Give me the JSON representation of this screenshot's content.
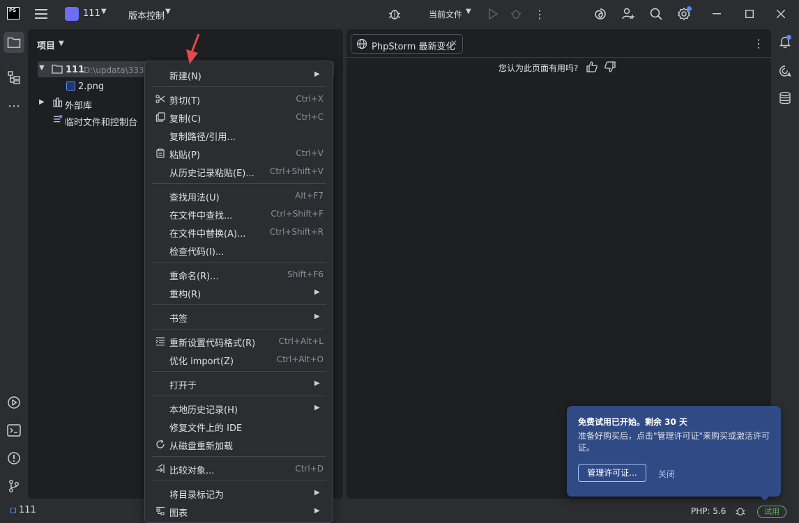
{
  "titlebar": {
    "logo_text": "PS",
    "project_name": "111",
    "vcs_label": "版本控制",
    "run_config": "当前文件"
  },
  "project_panel": {
    "header": "项目",
    "tree": {
      "root_name": "111",
      "root_path": "D:\\updata\\333\\",
      "file": "2.png",
      "external_libs": "外部库",
      "scratches": "临时文件和控制台"
    }
  },
  "context_menu": {
    "items": [
      {
        "label": "新建(N)",
        "shortcut": "",
        "submenu": true
      },
      {
        "label": "剪切(T)",
        "shortcut": "Ctrl+X",
        "icon": "scissors-icon"
      },
      {
        "label": "复制(C)",
        "shortcut": "Ctrl+C",
        "icon": "copy-icon"
      },
      {
        "label": "复制路径/引用...",
        "shortcut": ""
      },
      {
        "label": "粘贴(P)",
        "shortcut": "Ctrl+V",
        "icon": "paste-icon"
      },
      {
        "label": "从历史记录粘贴(E)...",
        "shortcut": "Ctrl+Shift+V"
      },
      {
        "label": "查找用法(U)",
        "shortcut": "Alt+F7"
      },
      {
        "label": "在文件中查找...",
        "shortcut": "Ctrl+Shift+F"
      },
      {
        "label": "在文件中替换(A)...",
        "shortcut": "Ctrl+Shift+R"
      },
      {
        "label": "检查代码(I)...",
        "shortcut": ""
      },
      {
        "label": "重命名(R)...",
        "shortcut": "Shift+F6"
      },
      {
        "label": "重构(R)",
        "shortcut": "",
        "submenu": true
      },
      {
        "label": "书签",
        "shortcut": "",
        "submenu": true
      },
      {
        "label": "重新设置代码格式(R)",
        "shortcut": "Ctrl+Alt+L",
        "icon": "reformat-icon"
      },
      {
        "label": "优化 import(Z)",
        "shortcut": "Ctrl+Alt+O"
      },
      {
        "label": "打开于",
        "shortcut": "",
        "submenu": true
      },
      {
        "label": "本地历史记录(H)",
        "shortcut": "",
        "submenu": true
      },
      {
        "label": "修复文件上的 IDE",
        "shortcut": ""
      },
      {
        "label": "从磁盘重新加载",
        "shortcut": "",
        "icon": "reload-icon"
      },
      {
        "label": "比较对象...",
        "shortcut": "Ctrl+D",
        "icon": "compare-icon"
      },
      {
        "label": "将目录标记为",
        "shortcut": "",
        "submenu": true
      },
      {
        "label": "图表",
        "shortcut": "",
        "submenu": true,
        "icon": "diagram-icon"
      }
    ]
  },
  "editor": {
    "tab_label": "PhpStorm 最新变化",
    "helpful_question": "您认为此页面有用吗?"
  },
  "trial_popup": {
    "title": "免费试用已开始。剩余 30 天",
    "body": "准备好购买后，点击\"管理许可证\"来购买或激活许可证。",
    "manage_button": "管理许可证...",
    "close_link": "关闭"
  },
  "statusbar": {
    "project": "111",
    "php_version": "PHP: 5.6",
    "trial_badge": "试用"
  },
  "colors": {
    "background": "#2b2d30",
    "panel": "#1e1f22",
    "accent": "#548af7",
    "popup": "#2f4a84",
    "trial_green": "#5fb865",
    "annotation_red": "#e5484d"
  }
}
